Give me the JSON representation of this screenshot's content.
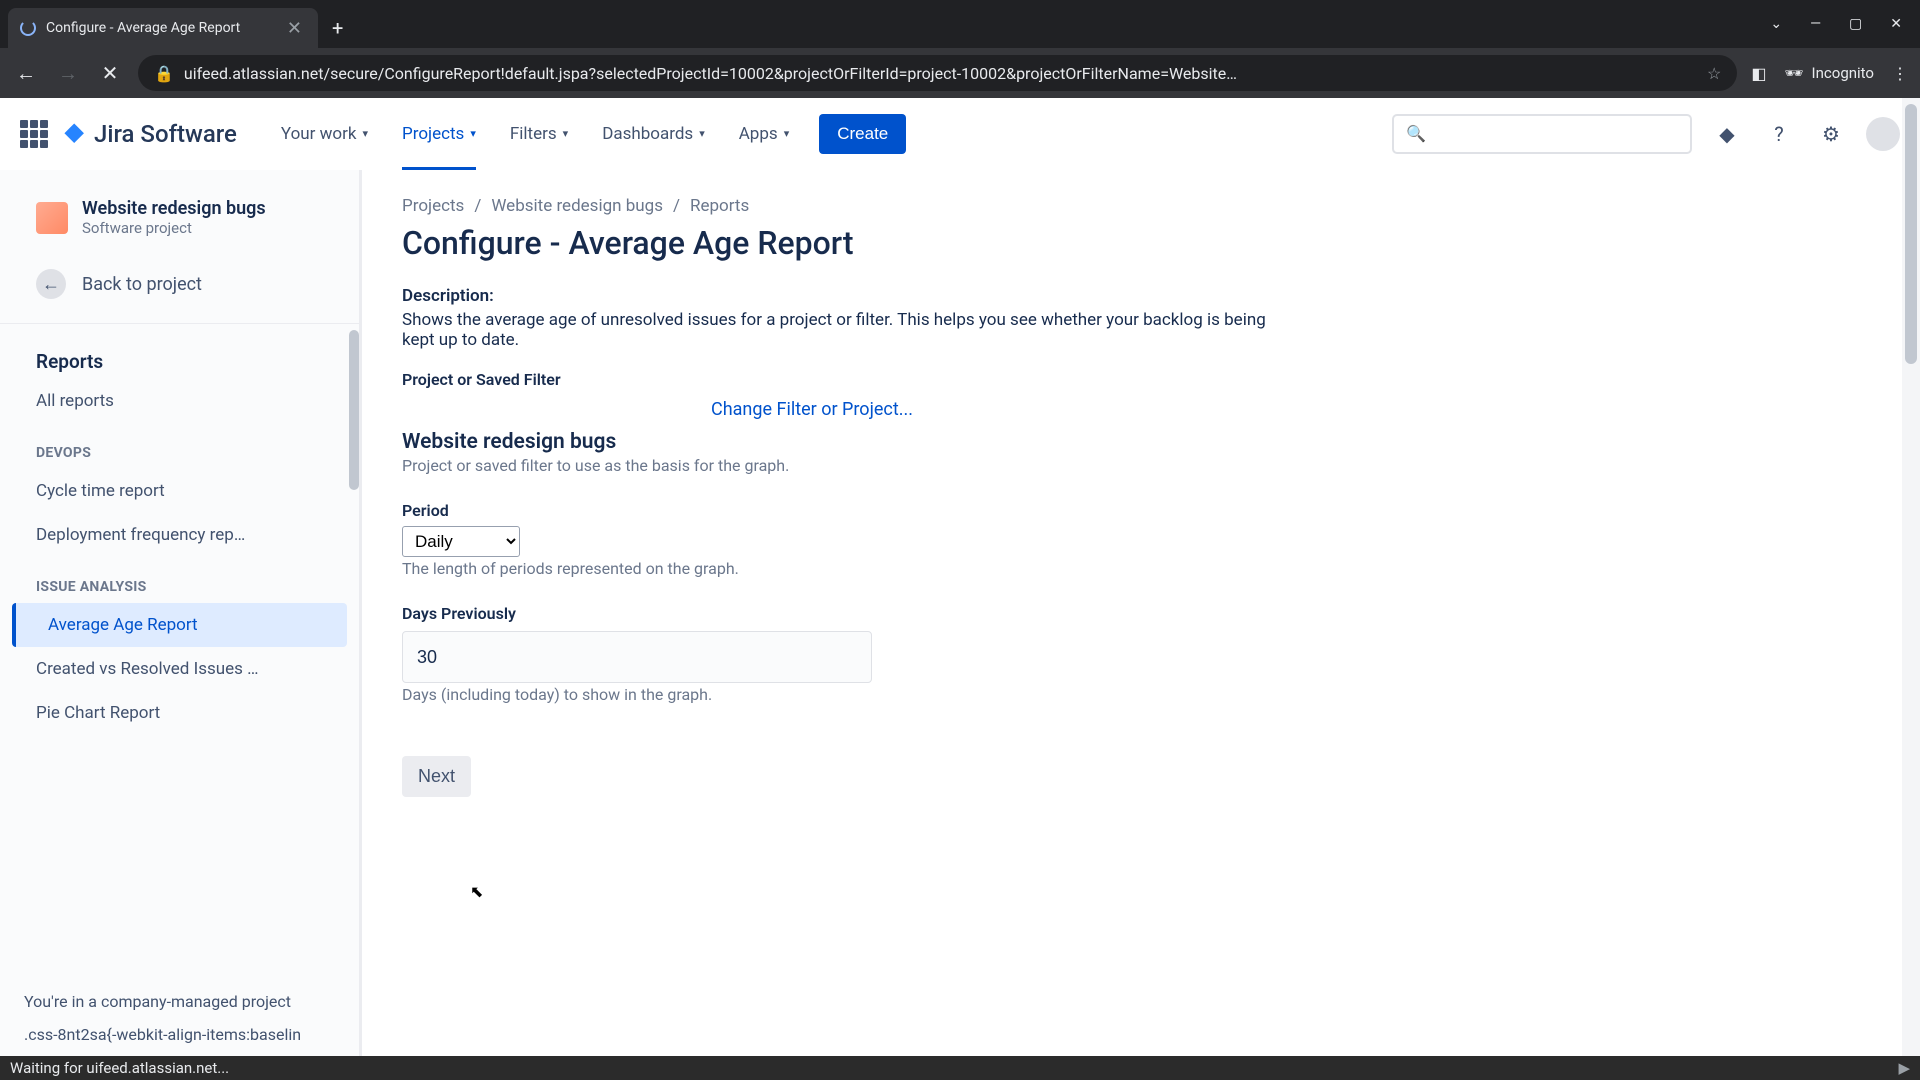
{
  "browser": {
    "tab_title": "Configure - Average Age Report",
    "url": "uifeed.atlassian.net/secure/ConfigureReport!default.jspa?selectedProjectId=10002&projectOrFilterId=project-10002&projectOrFilterName=Website…",
    "incognito_label": "Incognito",
    "chrome_controls": {
      "tabs": "⌄",
      "min": "—",
      "max": "▢",
      "close": "✕"
    }
  },
  "status_bar": "Waiting for uifeed.atlassian.net...",
  "topnav": {
    "logo": "Jira Software",
    "items": [
      {
        "label": "Your work",
        "active": false
      },
      {
        "label": "Projects",
        "active": true
      },
      {
        "label": "Filters",
        "active": false
      },
      {
        "label": "Dashboards",
        "active": false
      },
      {
        "label": "Apps",
        "active": false
      }
    ],
    "create": "Create"
  },
  "sidebar": {
    "project_name": "Website redesign bugs",
    "project_type": "Software project",
    "back": "Back to project",
    "reports_heading": "Reports",
    "all_reports": "All reports",
    "groups": [
      {
        "group": "DEVOPS",
        "items": [
          "Cycle time report",
          "Deployment frequency rep…"
        ]
      },
      {
        "group": "ISSUE ANALYSIS",
        "items": [
          "Average Age Report",
          "Created vs Resolved Issues …",
          "Pie Chart Report"
        ]
      }
    ],
    "active_item": "Average Age Report",
    "footer": "You're in a company-managed project",
    "debug": ".css-8nt2sa{-webkit-align-items:baselin"
  },
  "breadcrumb": [
    "Projects",
    "Website redesign bugs",
    "Reports"
  ],
  "main": {
    "title": "Configure - Average Age Report",
    "description_label": "Description:",
    "description_text": "Shows the average age of unresolved issues for a project or filter. This helps you see whether your backlog is being kept up to date.",
    "filter_label": "Project or Saved Filter",
    "change_filter": "Change Filter or Project...",
    "filter_value": "Website redesign bugs",
    "filter_hint": "Project or saved filter to use as the basis for the graph.",
    "period_label": "Period",
    "period_value": "Daily",
    "period_hint": "The length of periods represented on the graph.",
    "days_label": "Days Previously",
    "days_value": "30",
    "days_hint": "Days (including today) to show in the graph.",
    "next": "Next"
  }
}
